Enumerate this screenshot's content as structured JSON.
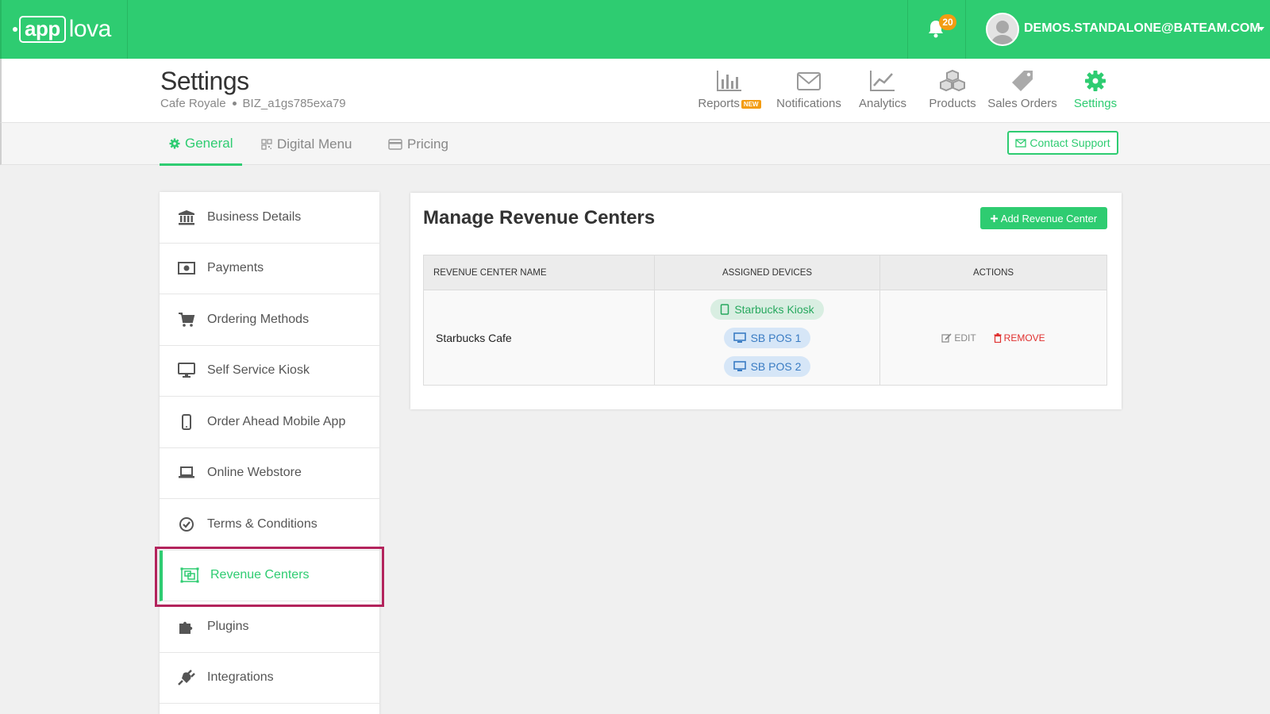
{
  "brand": {
    "logo_box": "app",
    "logo_rest": "lova"
  },
  "topbar": {
    "notification_count": "20",
    "user_email": "DEMOS.STANDALONE@BATEAM.COM"
  },
  "header": {
    "title": "Settings",
    "business_name": "Cafe Royale",
    "business_id": "BIZ_a1gs785exa79",
    "nav": [
      {
        "label": "Reports",
        "icon": "bar-chart-icon",
        "badge": "NEW"
      },
      {
        "label": "Notifications",
        "icon": "envelope-icon"
      },
      {
        "label": "Analytics",
        "icon": "line-chart-icon"
      },
      {
        "label": "Products",
        "icon": "cubes-icon"
      },
      {
        "label": "Sales Orders",
        "icon": "tag-icon"
      },
      {
        "label": "Settings",
        "icon": "gear-icon",
        "active": true
      }
    ]
  },
  "subtabs": {
    "items": [
      {
        "label": "General",
        "icon": "gear-icon",
        "active": true
      },
      {
        "label": "Digital Menu",
        "icon": "qr-icon"
      },
      {
        "label": "Pricing",
        "icon": "credit-card-icon"
      }
    ],
    "contact_support": "Contact Support"
  },
  "sidebar": {
    "items": [
      {
        "label": "Business Details",
        "icon": "bank-icon"
      },
      {
        "label": "Payments",
        "icon": "money-icon"
      },
      {
        "label": "Ordering Methods",
        "icon": "cart-icon"
      },
      {
        "label": "Self Service Kiosk",
        "icon": "desktop-icon"
      },
      {
        "label": "Order Ahead Mobile App",
        "icon": "mobile-icon"
      },
      {
        "label": "Online Webstore",
        "icon": "laptop-icon"
      },
      {
        "label": "Terms & Conditions",
        "icon": "check-circle-icon"
      },
      {
        "label": "Revenue Centers",
        "icon": "object-group-icon",
        "active": true
      },
      {
        "label": "Plugins",
        "icon": "puzzle-icon"
      },
      {
        "label": "Integrations",
        "icon": "plug-icon"
      }
    ]
  },
  "main": {
    "title": "Manage Revenue Centers",
    "add_button": "Add Revenue Center",
    "table": {
      "headers": [
        "REVENUE CENTER NAME",
        "ASSIGNED DEVICES",
        "ACTIONS"
      ],
      "rows": [
        {
          "name": "Starbucks Cafe",
          "devices": [
            {
              "label": "Starbucks Kiosk",
              "type": "kiosk"
            },
            {
              "label": "SB POS 1",
              "type": "pos"
            },
            {
              "label": "SB POS 2",
              "type": "pos"
            }
          ],
          "edit_label": "EDIT",
          "remove_label": "REMOVE"
        }
      ]
    }
  },
  "colors": {
    "brand_green": "#2ecc71",
    "badge_orange": "#f39c12",
    "remove_red": "#e0302f",
    "highlight_border": "#b3245c"
  }
}
